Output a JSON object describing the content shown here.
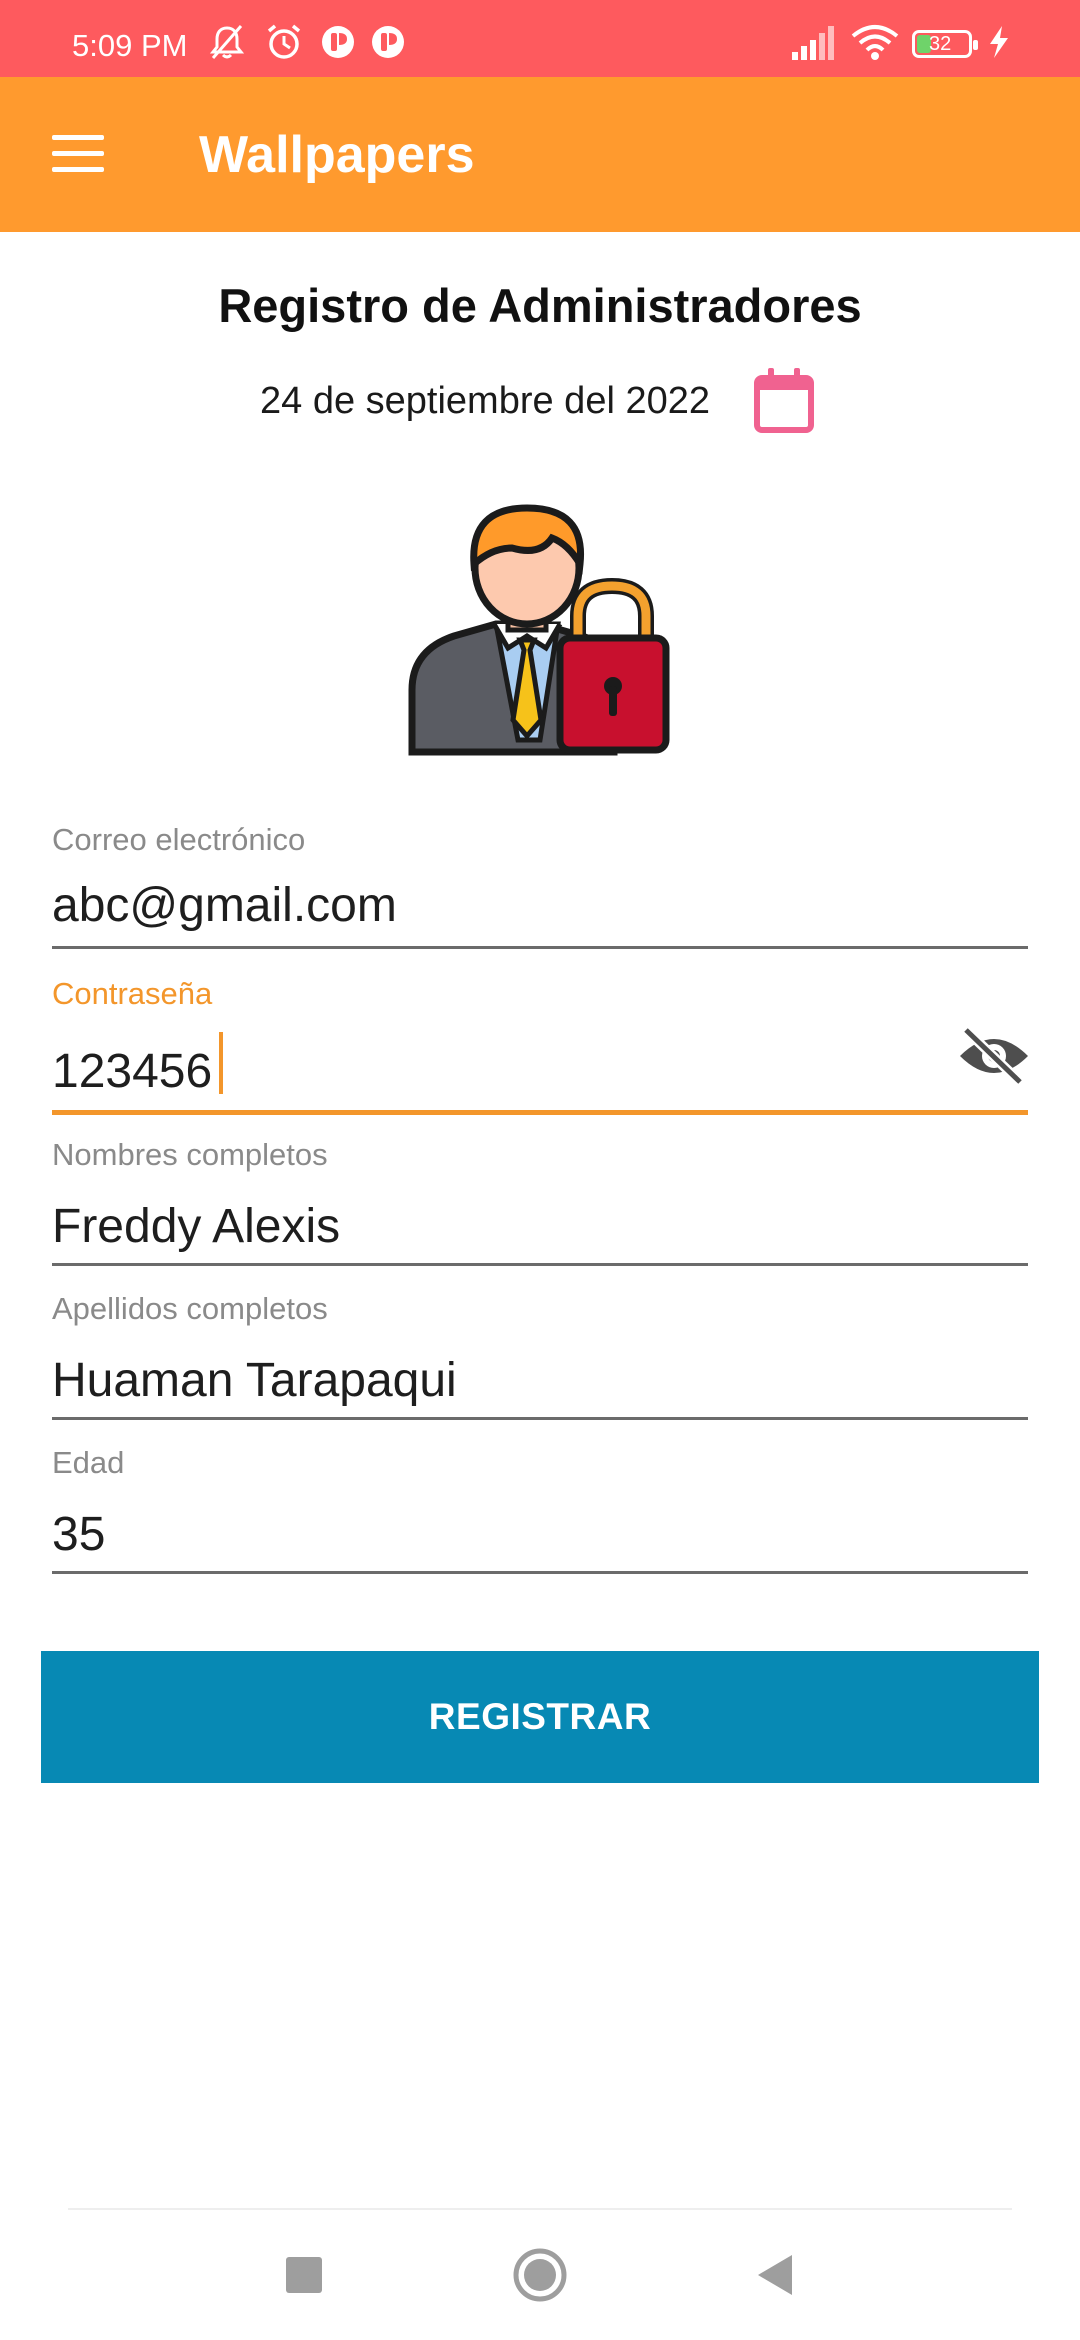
{
  "status_bar": {
    "time": "5:09 PM",
    "battery_level": "32",
    "icons": [
      "mute-icon",
      "alarm-icon",
      "app-notification-icon",
      "app-notification-icon",
      "signal-icon",
      "wifi-icon",
      "battery-icon",
      "charging-icon"
    ]
  },
  "app_bar": {
    "title": "Wallpapers",
    "menu_icon": "hamburger-menu-icon"
  },
  "header": {
    "title": "Registro de Administradores",
    "date": "24 de septiembre del 2022",
    "calendar_icon": "calendar-icon"
  },
  "form": {
    "email": {
      "label": "Correo electrónico",
      "value": "abc@gmail.com"
    },
    "password": {
      "label": "Contraseña",
      "value": "123456",
      "toggle_icon": "eye-off-icon"
    },
    "first_names": {
      "label": "Nombres completos",
      "value": "Freddy Alexis"
    },
    "last_names": {
      "label": "Apellidos completos",
      "value": "Huaman Tarapaqui"
    },
    "age": {
      "label": "Edad",
      "value": "35"
    }
  },
  "actions": {
    "register_label": "REGISTRAR"
  },
  "nav_bar": {
    "recent": "recent-apps-icon",
    "home": "home-icon",
    "back": "back-icon"
  },
  "colors": {
    "status_bar": "#fe5a5e",
    "app_bar": "#ff9a2e",
    "accent": "#f3962b",
    "button": "#0789b4",
    "calendar": "#f06290"
  }
}
